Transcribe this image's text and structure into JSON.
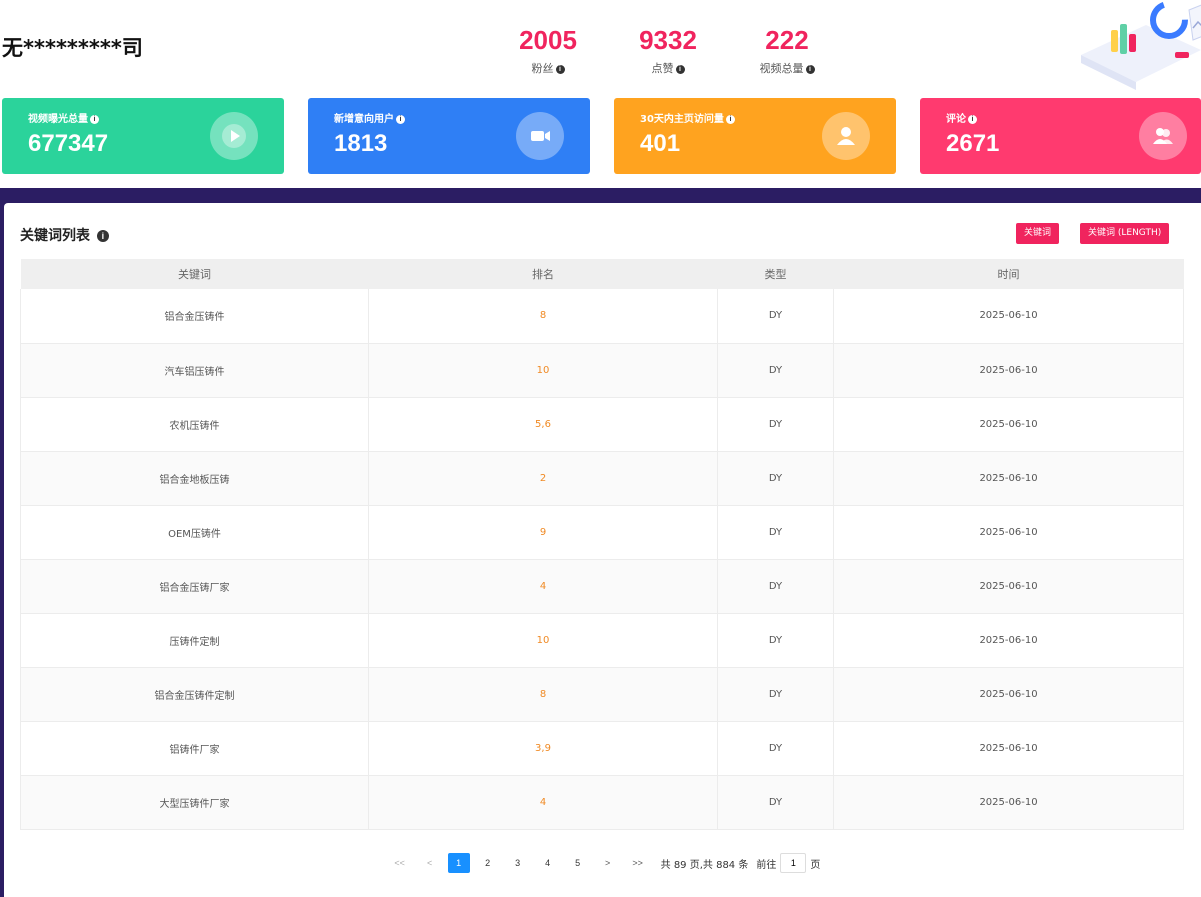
{
  "header": {
    "company": "无*********司",
    "stats": [
      {
        "value": "2005",
        "label": "粉丝"
      },
      {
        "value": "9332",
        "label": "点赞"
      },
      {
        "value": "222",
        "label": "视频总量"
      }
    ]
  },
  "cards": [
    {
      "title": "视频曝光总量",
      "value": "677347",
      "color": "#2bd39b",
      "icon": "play-icon"
    },
    {
      "title": "新增意向用户",
      "value": "1813",
      "color": "#2f7ff5",
      "icon": "video-camera-icon"
    },
    {
      "title": "30天内主页访问量",
      "value": "401",
      "color": "#ffa31f",
      "icon": "user-icon"
    },
    {
      "title": "评论",
      "value": "2671",
      "color": "#ff3a6f",
      "icon": "users-icon"
    }
  ],
  "panel": {
    "title": "关键词列表",
    "tag1": "关键词",
    "tag2": "关键词 (LENGTH)",
    "columns": [
      "关键词",
      "排名",
      "类型",
      "时间"
    ],
    "rows": [
      {
        "keyword": "铝合金压铸件",
        "rank": "8",
        "type": "DY",
        "date": "2025-06-10"
      },
      {
        "keyword": "汽车铝压铸件",
        "rank": "10",
        "type": "DY",
        "date": "2025-06-10"
      },
      {
        "keyword": "农机压铸件",
        "rank": "5,6",
        "type": "DY",
        "date": "2025-06-10"
      },
      {
        "keyword": "铝合金地板压铸",
        "rank": "2",
        "type": "DY",
        "date": "2025-06-10"
      },
      {
        "keyword": "OEM压铸件",
        "rank": "9",
        "type": "DY",
        "date": "2025-06-10"
      },
      {
        "keyword": "铝合金压铸厂家",
        "rank": "4",
        "type": "DY",
        "date": "2025-06-10"
      },
      {
        "keyword": "压铸件定制",
        "rank": "10",
        "type": "DY",
        "date": "2025-06-10"
      },
      {
        "keyword": "铝合金压铸件定制",
        "rank": "8",
        "type": "DY",
        "date": "2025-06-10"
      },
      {
        "keyword": "铝铸件厂家",
        "rank": "3,9",
        "type": "DY",
        "date": "2025-06-10"
      },
      {
        "keyword": "大型压铸件厂家",
        "rank": "4",
        "type": "DY",
        "date": "2025-06-10"
      }
    ]
  },
  "pager": {
    "first": "<<",
    "prev": "<",
    "pages": [
      "1",
      "2",
      "3",
      "4",
      "5"
    ],
    "active": "1",
    "next": ">",
    "last": ">>",
    "summary": "共 89 页,共 884 条",
    "goto_label": "前往",
    "goto_value": "1",
    "page_unit": "页"
  }
}
